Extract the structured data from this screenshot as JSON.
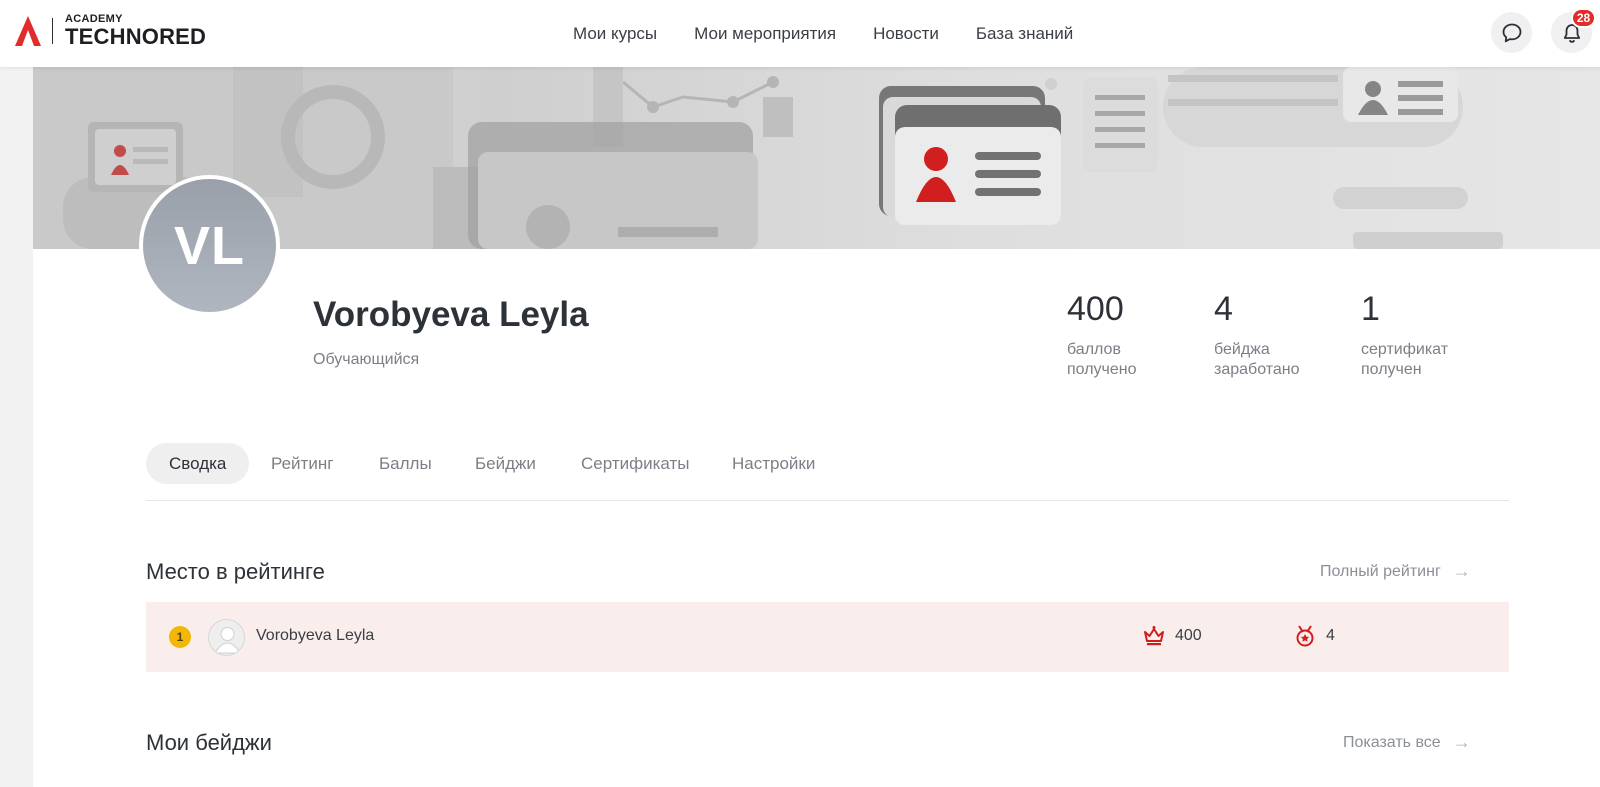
{
  "header": {
    "logo_small": "ACADEMY",
    "logo_big": "TECHNORED",
    "nav": [
      "Мои курсы",
      "Мои мероприятия",
      "Новости",
      "База знаний"
    ],
    "notification_count": "28",
    "icons": {
      "chat": "chat-bubble-icon",
      "bell": "bell-icon"
    }
  },
  "profile": {
    "initials": "VL",
    "name": "Vorobyeva Leyla",
    "role": "Обучающийся",
    "stats": [
      {
        "value": "400",
        "label": "баллов получено"
      },
      {
        "value": "4",
        "label": "бейджа заработано"
      },
      {
        "value": "1",
        "label": "сертификат получен"
      }
    ]
  },
  "tabs": [
    "Сводка",
    "Рейтинг",
    "Баллы",
    "Бейджи",
    "Сертификаты",
    "Настройки"
  ],
  "rating": {
    "title": "Место в рейтинге",
    "link": "Полный рейтинг",
    "row": {
      "place": "1",
      "name": "Vorobyeva Leyla",
      "points": "400",
      "badges": "4"
    }
  },
  "badges": {
    "title": "Мои бейджи",
    "link": "Показать все"
  },
  "colors": {
    "accent": "#e22b2b",
    "highlight_row": "#f9eeec",
    "place_gold": "#f2b705",
    "avatar": "#a4aab3"
  }
}
